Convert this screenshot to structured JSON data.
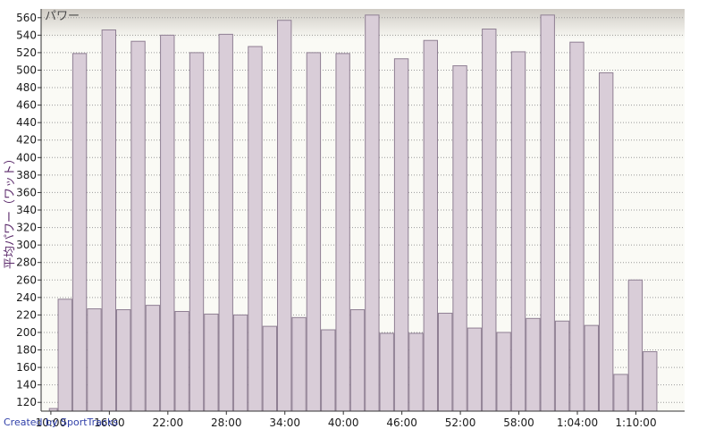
{
  "chart_data": {
    "type": "bar",
    "title": "パワー",
    "ylabel": "平均パワー（ワット）",
    "xlabel": "",
    "ylim": [
      110,
      570
    ],
    "yticks": [
      120,
      140,
      160,
      180,
      200,
      220,
      240,
      260,
      280,
      300,
      320,
      340,
      360,
      380,
      400,
      420,
      440,
      460,
      480,
      500,
      520,
      540,
      560
    ],
    "xlim_seconds": [
      540,
      4500
    ],
    "xticks": [
      {
        "seconds": 600,
        "label": "10:00"
      },
      {
        "seconds": 960,
        "label": "16:00"
      },
      {
        "seconds": 1320,
        "label": "22:00"
      },
      {
        "seconds": 1680,
        "label": "28:00"
      },
      {
        "seconds": 2040,
        "label": "34:00"
      },
      {
        "seconds": 2400,
        "label": "40:00"
      },
      {
        "seconds": 2760,
        "label": "46:00"
      },
      {
        "seconds": 3120,
        "label": "52:00"
      },
      {
        "seconds": 3480,
        "label": "58:00"
      },
      {
        "seconds": 3840,
        "label": "1:04:00"
      },
      {
        "seconds": 4200,
        "label": "1:10:00"
      }
    ],
    "bars": [
      {
        "start": "9:48",
        "end": "10:42",
        "value": 113
      },
      {
        "start": "10:42",
        "end": "12:12",
        "value": 238
      },
      {
        "start": "12:12",
        "end": "13:42",
        "value": 519
      },
      {
        "start": "13:42",
        "end": "15:12",
        "value": 227
      },
      {
        "start": "15:12",
        "end": "16:42",
        "value": 546
      },
      {
        "start": "16:42",
        "end": "18:12",
        "value": 226
      },
      {
        "start": "18:12",
        "end": "19:42",
        "value": 533
      },
      {
        "start": "19:42",
        "end": "21:12",
        "value": 231
      },
      {
        "start": "21:12",
        "end": "22:42",
        "value": 540
      },
      {
        "start": "22:42",
        "end": "24:12",
        "value": 224
      },
      {
        "start": "24:12",
        "end": "25:42",
        "value": 520
      },
      {
        "start": "25:42",
        "end": "27:12",
        "value": 221
      },
      {
        "start": "27:12",
        "end": "28:42",
        "value": 541
      },
      {
        "start": "28:42",
        "end": "30:12",
        "value": 220
      },
      {
        "start": "30:12",
        "end": "31:42",
        "value": 527
      },
      {
        "start": "31:42",
        "end": "33:12",
        "value": 207
      },
      {
        "start": "33:12",
        "end": "34:42",
        "value": 557
      },
      {
        "start": "34:42",
        "end": "36:12",
        "value": 217
      },
      {
        "start": "36:12",
        "end": "37:42",
        "value": 520
      },
      {
        "start": "37:42",
        "end": "39:12",
        "value": 203
      },
      {
        "start": "39:12",
        "end": "40:42",
        "value": 519
      },
      {
        "start": "40:42",
        "end": "42:12",
        "value": 226
      },
      {
        "start": "42:12",
        "end": "43:42",
        "value": 563
      },
      {
        "start": "43:42",
        "end": "45:12",
        "value": 199
      },
      {
        "start": "45:12",
        "end": "46:42",
        "value": 513
      },
      {
        "start": "46:42",
        "end": "48:12",
        "value": 199
      },
      {
        "start": "48:12",
        "end": "49:42",
        "value": 534
      },
      {
        "start": "49:42",
        "end": "51:12",
        "value": 222
      },
      {
        "start": "51:12",
        "end": "52:42",
        "value": 505
      },
      {
        "start": "52:42",
        "end": "54:12",
        "value": 205
      },
      {
        "start": "54:12",
        "end": "55:42",
        "value": 547
      },
      {
        "start": "55:42",
        "end": "57:12",
        "value": 200
      },
      {
        "start": "57:12",
        "end": "58:42",
        "value": 521
      },
      {
        "start": "58:42",
        "end": "1:00:12",
        "value": 216
      },
      {
        "start": "1:00:12",
        "end": "1:01:42",
        "value": 563
      },
      {
        "start": "1:01:42",
        "end": "1:03:12",
        "value": 213
      },
      {
        "start": "1:03:12",
        "end": "1:04:42",
        "value": 532
      },
      {
        "start": "1:04:42",
        "end": "1:06:12",
        "value": 208
      },
      {
        "start": "1:06:12",
        "end": "1:07:42",
        "value": 497
      },
      {
        "start": "1:07:42",
        "end": "1:09:12",
        "value": 152
      },
      {
        "start": "1:09:12",
        "end": "1:10:42",
        "value": 260
      },
      {
        "start": "1:10:42",
        "end": "1:12:12",
        "value": 178
      }
    ],
    "grid": true,
    "colors": {
      "bar_fill": "#d9cdd8",
      "bar_stroke": "#8f7f93",
      "plot_background": "#fafaf5",
      "grid": "#9a9a9a"
    }
  },
  "credit": "Created by SportTracks"
}
